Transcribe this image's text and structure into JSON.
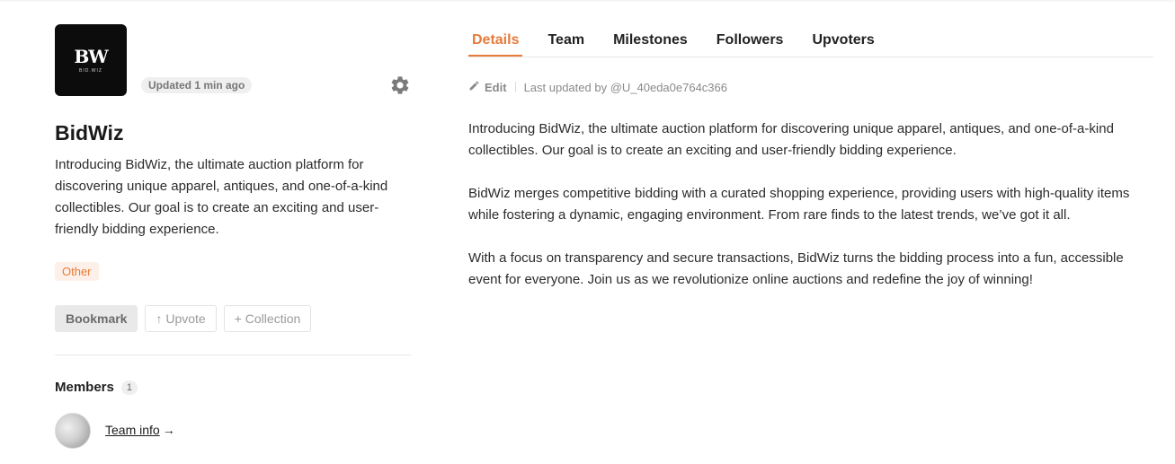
{
  "project": {
    "logo_text": "BW",
    "logo_subtext": "BID.WIZ",
    "updated_badge": "Updated 1 min ago",
    "name": "BidWiz",
    "short_description": "Introducing BidWiz, the ultimate auction platform for discovering unique apparel, antiques, and one-of-a-kind collectibles. Our goal is to create an exciting and user-friendly bidding experience.",
    "category_tag": "Other"
  },
  "actions": {
    "bookmark_label": "Bookmark",
    "upvote_label": "↑ Upvote",
    "collection_label": "+ Collection"
  },
  "members": {
    "title": "Members",
    "count": "1",
    "team_info_label": "Team info",
    "team_info_arrow": "→"
  },
  "tabs": [
    {
      "label": "Details"
    },
    {
      "label": "Team"
    },
    {
      "label": "Milestones"
    },
    {
      "label": "Followers"
    },
    {
      "label": "Upvoters"
    }
  ],
  "details": {
    "edit_label": "Edit",
    "last_updated": "Last updated by @U_40eda0e764c366",
    "paragraphs": [
      "Introducing BidWiz, the ultimate auction platform for discovering unique apparel, antiques, and one-of-a-kind collectibles. Our goal is to create an exciting and user-friendly bidding experience.",
      "BidWiz merges competitive bidding with a curated shopping experience, providing users with high-quality items while fostering a dynamic, engaging environment. From rare finds to the latest trends, we’ve got it all.",
      "With a focus on transparency and secure transactions, BidWiz turns the bidding process into a fun, accessible event for everyone. Join us as we revolutionize online auctions and redefine the joy of winning!"
    ]
  },
  "colors": {
    "accent": "#e67b3a",
    "tag_bg": "#fdf0e8",
    "logo_bg": "#0c0c0c"
  },
  "icons": [
    "gear-icon",
    "pencil-icon",
    "arrow-right-icon"
  ]
}
